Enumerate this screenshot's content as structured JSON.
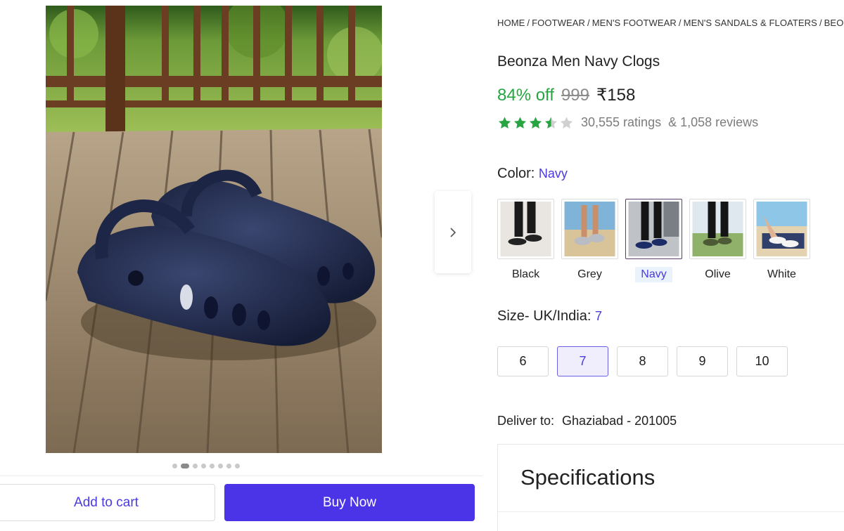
{
  "gallery": {
    "alt": "Navy clogs on wooden deck",
    "dots_count": 8,
    "active_dot": 1
  },
  "actions": {
    "add_to_cart": "Add to cart",
    "buy_now": "Buy Now"
  },
  "breadcrumb": [
    "HOME",
    "FOOTWEAR",
    "MEN'S FOOTWEAR",
    "MEN'S SANDALS & FLOATERS",
    "BEONZA MEN NAVY CLOGS"
  ],
  "product": {
    "title": "Beonza Men Navy Clogs",
    "discount": "84% off",
    "mrp": "999",
    "price": "₹158",
    "rating_value": 3.5,
    "ratings": "30,555 ratings",
    "reviews": "& 1,058 reviews"
  },
  "color": {
    "label": "Color:",
    "selected": "Navy",
    "options": [
      "Black",
      "Grey",
      "Navy",
      "Olive",
      "White"
    ]
  },
  "size": {
    "label": "Size- UK/India:",
    "selected": "7",
    "options": [
      "6",
      "7",
      "8",
      "9",
      "10"
    ]
  },
  "delivery": {
    "label": "Deliver to:",
    "location": "Ghaziabad - 201005"
  },
  "specifications": {
    "title": "Specifications"
  },
  "colors": {
    "accent": "#4b33e8",
    "discount_green": "#26a541",
    "star_green": "#26a541"
  }
}
